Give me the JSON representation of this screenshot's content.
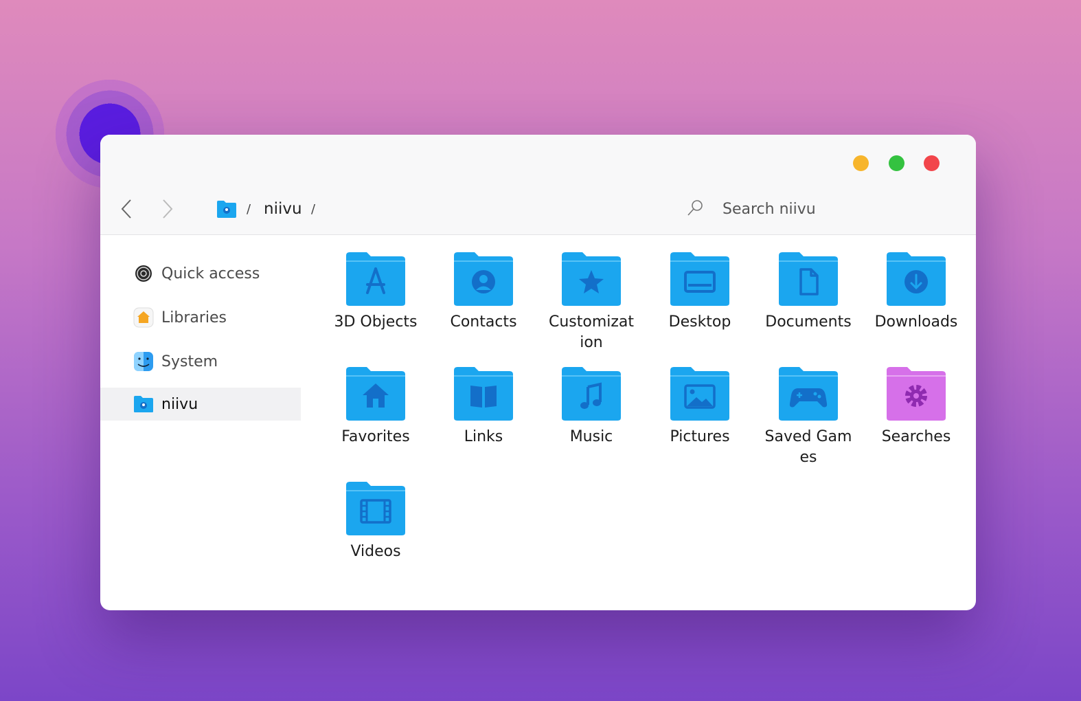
{
  "window": {
    "controls": {
      "minimize_color": "#f7b52c",
      "maximize_color": "#34c240",
      "close_color": "#f2454b"
    }
  },
  "toolbar": {
    "breadcrumb": {
      "folder": "niivu",
      "separator": "/"
    },
    "search_placeholder": "Search niivu"
  },
  "sidebar": {
    "items": [
      {
        "label": "Quick access",
        "icon": "quick-access-icon"
      },
      {
        "label": "Libraries",
        "icon": "libraries-home-icon"
      },
      {
        "label": "System",
        "icon": "finder-face-icon"
      },
      {
        "label": "niivu",
        "icon": "user-folder-icon",
        "selected": true
      }
    ]
  },
  "files": [
    {
      "label": "3D Objects",
      "icon": "app-store-icon"
    },
    {
      "label": "Contacts",
      "icon": "person-icon"
    },
    {
      "label": "Customizat ion",
      "icon": "star-icon"
    },
    {
      "label": "Desktop",
      "icon": "desktop-icon"
    },
    {
      "label": "Documents",
      "icon": "document-icon"
    },
    {
      "label": "Downloads",
      "icon": "download-icon"
    },
    {
      "label": "Favorites",
      "icon": "home-icon"
    },
    {
      "label": "Links",
      "icon": "book-icon"
    },
    {
      "label": "Music",
      "icon": "music-note-icon"
    },
    {
      "label": "Pictures",
      "icon": "picture-icon"
    },
    {
      "label": "Saved Games",
      "icon": "gamepad-icon"
    },
    {
      "label": "Searches",
      "icon": "gear-icon"
    },
    {
      "label": "Videos",
      "icon": "film-icon"
    }
  ],
  "colors": {
    "folder_blue": "#1ba6ef",
    "folder_pink": "#d670e9",
    "accent_dark": "#136fc9"
  }
}
